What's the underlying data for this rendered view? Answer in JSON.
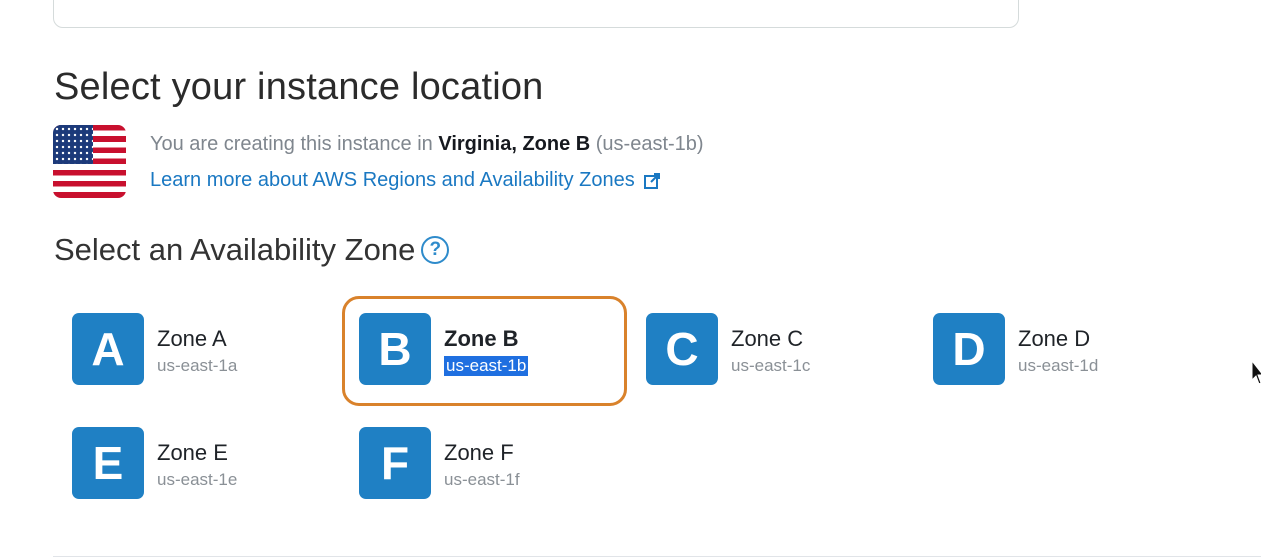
{
  "section_title": "Select your instance location",
  "location": {
    "prefix": "You are creating this instance in ",
    "region_zone": "Virginia, Zone B",
    "suffix": " (us-east-1b)",
    "flag_icon": "us-flag-icon"
  },
  "learn_link": {
    "label": "Learn more about AWS Regions and Availability Zones",
    "icon": "external-link-icon"
  },
  "availability_zone": {
    "title": "Select an Availability Zone",
    "help_icon": "?"
  },
  "zones": [
    {
      "letter": "A",
      "name": "Zone A",
      "code": "us-east-1a",
      "selected": false
    },
    {
      "letter": "B",
      "name": "Zone B",
      "code": "us-east-1b",
      "selected": true
    },
    {
      "letter": "C",
      "name": "Zone C",
      "code": "us-east-1c",
      "selected": false
    },
    {
      "letter": "D",
      "name": "Zone D",
      "code": "us-east-1d",
      "selected": false
    },
    {
      "letter": "E",
      "name": "Zone E",
      "code": "us-east-1e",
      "selected": false
    },
    {
      "letter": "F",
      "name": "Zone F",
      "code": "us-east-1f",
      "selected": false
    }
  ],
  "colors": {
    "zone_badge": "#1f80c4",
    "selected_border": "#d9822b",
    "link": "#1a78c2",
    "selection_highlight": "#1f6fe0"
  }
}
